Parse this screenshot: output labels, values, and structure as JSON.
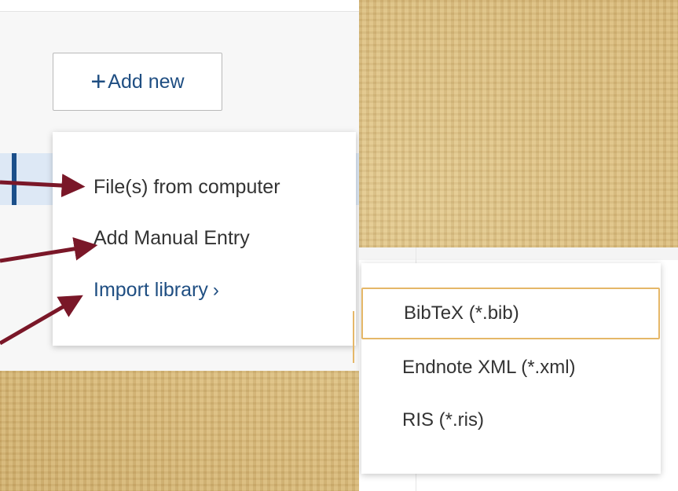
{
  "left_panel": {
    "add_new_button": {
      "icon": "plus-icon",
      "icon_glyph": "+",
      "label": "Add new"
    },
    "dropdown_menu": {
      "items": [
        {
          "label": "File(s) from computer"
        },
        {
          "label": "Add Manual Entry"
        },
        {
          "label": "Import library",
          "icon": "chevron-right-icon",
          "icon_glyph": "›"
        }
      ]
    }
  },
  "right_panel": {
    "import_submenu": {
      "items": [
        {
          "label": "BibTeX (*.bib)",
          "highlighted": true
        },
        {
          "label": "Endnote XML (*.xml)"
        },
        {
          "label": "RIS (*.ris)"
        }
      ]
    }
  },
  "colors": {
    "accent_blue": "#1f4e82",
    "selected_bar": "#1b4f8a",
    "selected_row": "#dde8f5",
    "highlight_border": "#e5b768",
    "arrow": "#7a1728",
    "background_papyrus": "#dcc089"
  }
}
